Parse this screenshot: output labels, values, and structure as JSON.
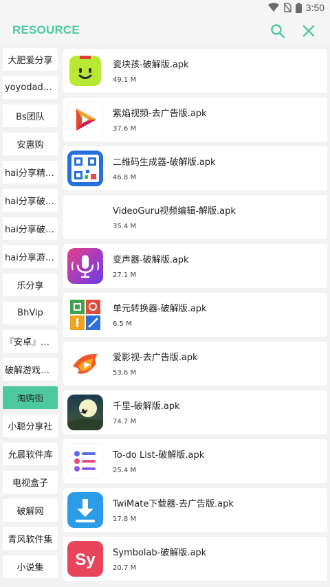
{
  "status": {
    "time": "3:50"
  },
  "header": {
    "title": "RESOURCE"
  },
  "sidebar": {
    "items": [
      {
        "label": "大肥爱分享",
        "active": false
      },
      {
        "label": "yoyodadada",
        "active": false
      },
      {
        "label": "Bs团队",
        "active": false
      },
      {
        "label": "安惠购",
        "active": false
      },
      {
        "label": "hai分享精选…",
        "active": false
      },
      {
        "label": "hai分享破解…",
        "active": false
      },
      {
        "label": "hai分享破解…",
        "active": false
      },
      {
        "label": "hai分享游戏…",
        "active": false
      },
      {
        "label": "乐分享",
        "active": false
      },
      {
        "label": "BhVip",
        "active": false
      },
      {
        "label": "『安卓』破…",
        "active": false
      },
      {
        "label": "破解游戏合集",
        "active": false
      },
      {
        "label": "淘购街",
        "active": true
      },
      {
        "label": "小聪分享社",
        "active": false
      },
      {
        "label": "允晨软件库",
        "active": false
      },
      {
        "label": "电视盒子",
        "active": false
      },
      {
        "label": "破解网",
        "active": false
      },
      {
        "label": "青风软件集",
        "active": false
      },
      {
        "label": "小说集",
        "active": false
      }
    ]
  },
  "apps": [
    {
      "name": "瓷块孩-破解版.apk",
      "size": "49.1 M",
      "icon": "smiley-face-icon"
    },
    {
      "name": "紫焰视频-去广告版.apk",
      "size": "37.6 M",
      "icon": "play-triangle-icon"
    },
    {
      "name": "二维码生成器-破解版.apk",
      "size": "46.8 M",
      "icon": "qr-code-icon"
    },
    {
      "name": "VideoGuru视频编辑-解版.apk",
      "size": "35.4 M",
      "icon": "blank-icon"
    },
    {
      "name": "变声器-破解版.apk",
      "size": "27.1 M",
      "icon": "microphone-icon"
    },
    {
      "name": "单元转换器-破解版.apk",
      "size": "6.5 M",
      "icon": "unit-converter-icon"
    },
    {
      "name": "爱影视-去广告版.apk",
      "size": "53.6 M",
      "icon": "flame-play-icon"
    },
    {
      "name": "千里-破解版.apk",
      "size": "74.7 M",
      "icon": "moon-witch-icon"
    },
    {
      "name": "To-do List-破解版.apk",
      "size": "25.4 M",
      "icon": "checklist-icon"
    },
    {
      "name": "TwiMate下载器-去广告版.apk",
      "size": "17.8 M",
      "icon": "download-arrow-icon"
    },
    {
      "name": "Symbolab-破解版.apk",
      "size": "20.7 M",
      "icon": "symbolab-sy-icon"
    }
  ],
  "colors": {
    "accent": "#4dc9a0"
  },
  "icon_names": {
    "search": "search-icon",
    "close": "close-icon",
    "wifi": "wifi-icon",
    "sim": "no-sim-icon",
    "battery": "battery-icon"
  }
}
